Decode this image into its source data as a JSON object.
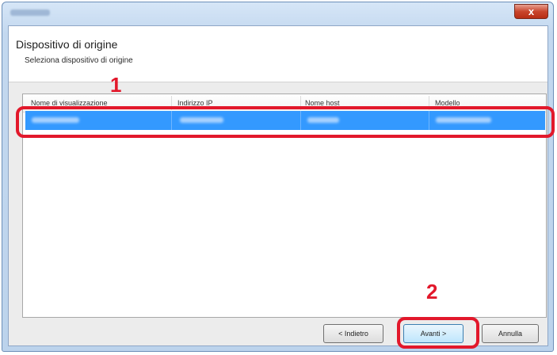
{
  "window": {
    "close_label": "x"
  },
  "header": {
    "title": "Dispositivo di origine",
    "subtitle": "Seleziona dispositivo di origine"
  },
  "list": {
    "columns": [
      "Nome di visualizzazione",
      "Indirizzo IP",
      "Nome host",
      "Modello"
    ]
  },
  "buttons": {
    "back": "< Indietro",
    "next": "Avanti >",
    "cancel": "Annulla"
  },
  "annotations": {
    "one": "1",
    "two": "2"
  },
  "colors": {
    "annotation": "#e2182b",
    "selection": "#3399ff"
  }
}
